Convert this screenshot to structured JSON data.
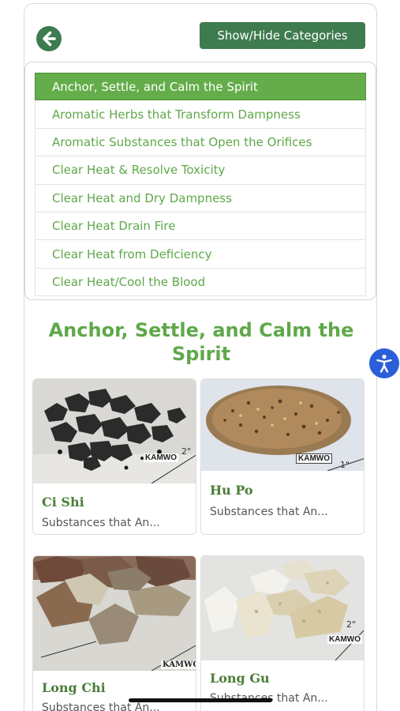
{
  "header": {
    "back_icon": "arrow-left-circle-icon",
    "toggle_label": "Show/Hide Categories"
  },
  "categories": {
    "selected_index": 0,
    "items": [
      "Anchor, Settle, and Calm the Spirit",
      "Aromatic Herbs that Transform Dampness",
      "Aromatic Substances that Open the Orifices",
      "Clear Heat & Resolve Toxicity",
      "Clear Heat and Dry Dampness",
      "Clear Heat Drain Fire",
      "Clear Heat from Deficiency",
      "Clear Heat/Cool the Blood"
    ]
  },
  "section": {
    "title": "Anchor, Settle, and Calm the Spirit"
  },
  "products": [
    {
      "name": "Ci Shi",
      "subtitle": "Substances that An...",
      "watermark": "KAMWO"
    },
    {
      "name": "Hu Po",
      "subtitle": "Substances that An...",
      "watermark": "KAMWO"
    },
    {
      "name": "Long Chi",
      "subtitle": "Substances that An...",
      "watermark": "KAMWO"
    },
    {
      "name": "Long Gu",
      "subtitle": "Substances that An...",
      "watermark": "KAMWO"
    }
  ],
  "accessibility_icon": "accessibility-person-icon",
  "colors": {
    "brand_green": "#3e7b4f",
    "accent_green": "#64ad4a",
    "text_green": "#5fa84a",
    "a11y_blue": "#2b5fd9"
  }
}
